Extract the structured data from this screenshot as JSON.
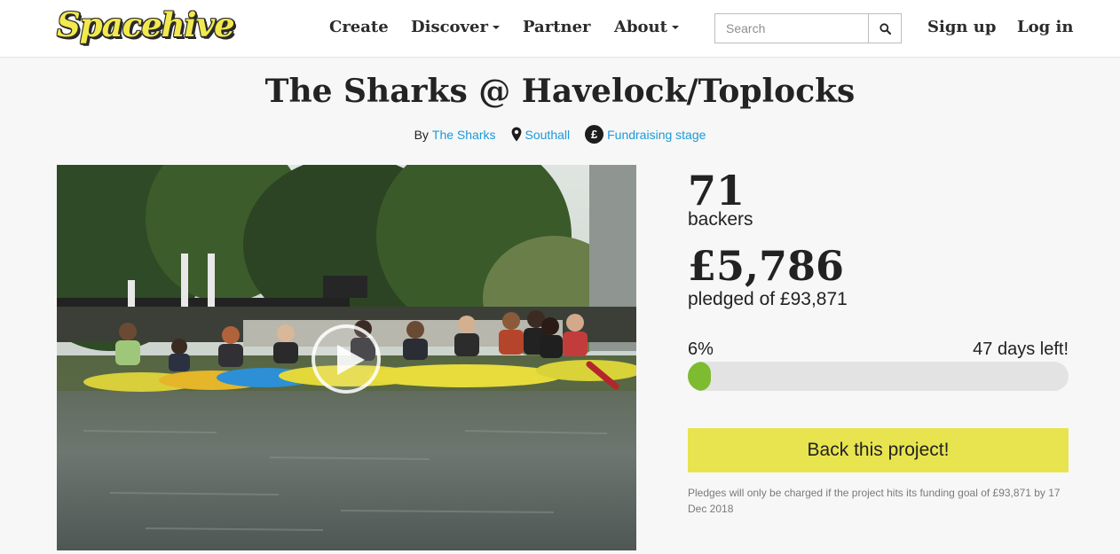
{
  "header": {
    "logo": "Spacehive",
    "nav": {
      "create": "Create",
      "discover": "Discover",
      "partner": "Partner",
      "about": "About"
    },
    "search": {
      "placeholder": "Search"
    },
    "sign_up": "Sign up",
    "log_in": "Log in"
  },
  "project": {
    "title": "The Sharks @ Havelock/Toplocks",
    "by_label": "By",
    "owner": "The Sharks",
    "location": "Southall",
    "stage": "Fundraising stage"
  },
  "stats": {
    "backers_count": "71",
    "backers_label": "backers",
    "pledged_amount": "£5,786",
    "pledged_label": "pledged of £93,871",
    "percent_text": "6%",
    "percent_value": 6,
    "days_left": "47 days left!"
  },
  "cta": {
    "back_label": "Back this project!",
    "disclaimer": "Pledges will only be charged if the project hits its funding goal of £93,871 by 17 Dec 2018"
  },
  "colors": {
    "accent_yellow": "#e8e44f",
    "link_blue": "#1b9ad6",
    "progress_green": "#7dbb30"
  }
}
